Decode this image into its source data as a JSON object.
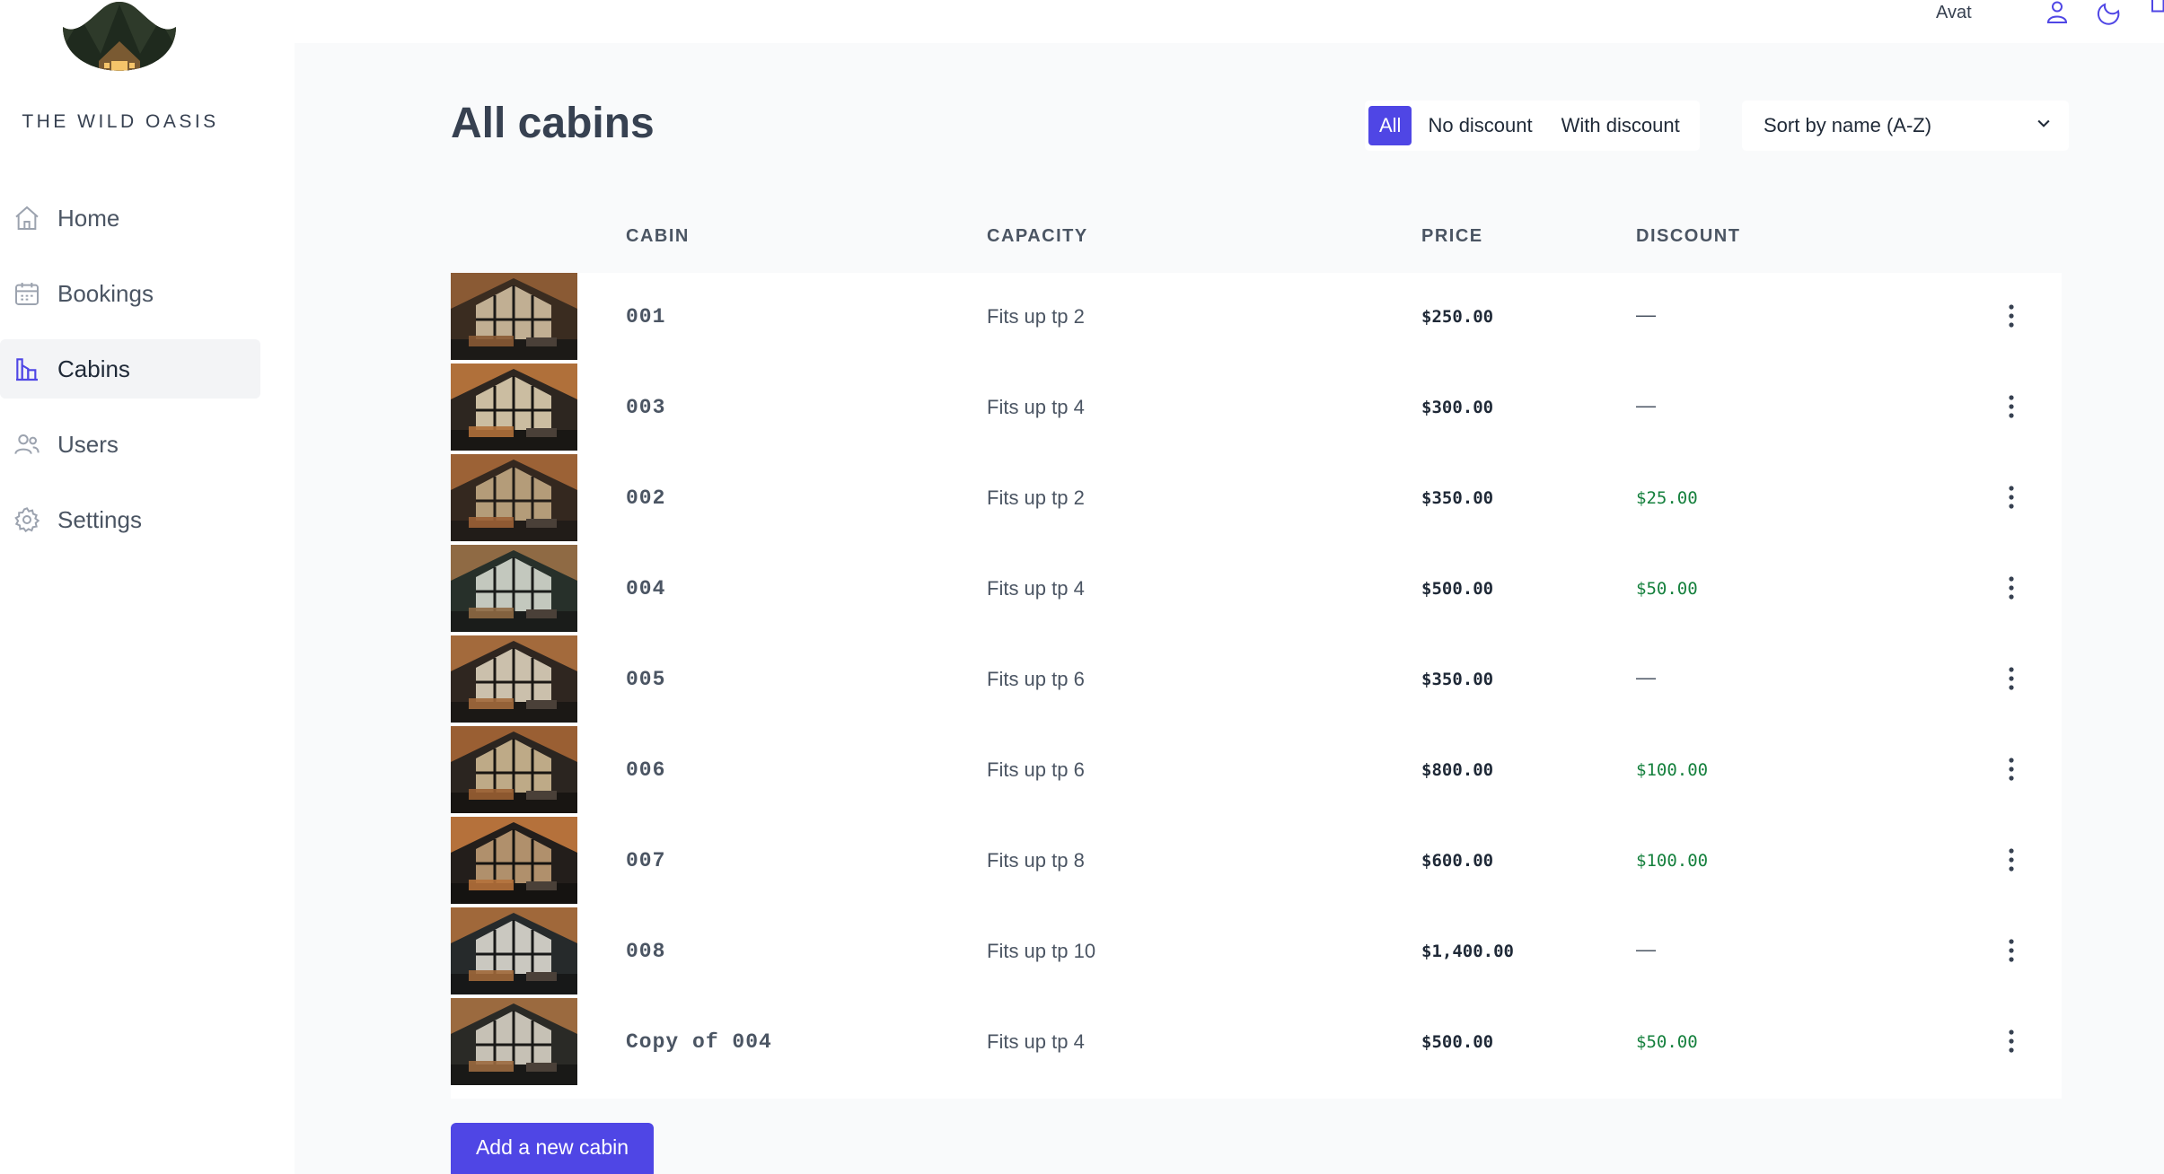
{
  "brand": {
    "name": "THE WILD OASIS"
  },
  "nav": [
    {
      "label": "Home",
      "icon": "home-icon",
      "active": false
    },
    {
      "label": "Bookings",
      "icon": "calendar-icon",
      "active": false
    },
    {
      "label": "Cabins",
      "icon": "cabins-icon",
      "active": true
    },
    {
      "label": "Users",
      "icon": "users-icon",
      "active": false
    },
    {
      "label": "Settings",
      "icon": "settings-icon",
      "active": false
    }
  ],
  "header": {
    "avatar_text": "Avat",
    "icons": [
      "user-icon",
      "moon-icon",
      "logout-icon"
    ]
  },
  "page": {
    "title": "All cabins"
  },
  "filter": {
    "options": [
      "All",
      "No discount",
      "With discount"
    ],
    "active": "All"
  },
  "sort": {
    "selected": "Sort by name (A-Z)"
  },
  "table": {
    "headers": [
      "CABIN",
      "CAPACITY",
      "PRICE",
      "DISCOUNT"
    ],
    "rows": [
      {
        "name": "001",
        "capacity": "Fits up tp 2",
        "price": "$250.00",
        "discount": "—"
      },
      {
        "name": "003",
        "capacity": "Fits up tp 4",
        "price": "$300.00",
        "discount": "—"
      },
      {
        "name": "002",
        "capacity": "Fits up tp 2",
        "price": "$350.00",
        "discount": "$25.00"
      },
      {
        "name": "004",
        "capacity": "Fits up tp 4",
        "price": "$500.00",
        "discount": "$50.00"
      },
      {
        "name": "005",
        "capacity": "Fits up tp 6",
        "price": "$350.00",
        "discount": "—"
      },
      {
        "name": "006",
        "capacity": "Fits up tp 6",
        "price": "$800.00",
        "discount": "$100.00"
      },
      {
        "name": "007",
        "capacity": "Fits up tp 8",
        "price": "$600.00",
        "discount": "$100.00"
      },
      {
        "name": "008",
        "capacity": "Fits up tp 10",
        "price": "$1,400.00",
        "discount": "—"
      },
      {
        "name": "Copy of 004",
        "capacity": "Fits up tp 4",
        "price": "$500.00",
        "discount": "$50.00"
      }
    ]
  },
  "actions": {
    "add_label": "Add a new cabin"
  },
  "colors": {
    "accent": "#4f46e5",
    "discount_green": "#15803d",
    "sidebar_bg": "#ffffff",
    "page_bg": "#f9fafb"
  }
}
